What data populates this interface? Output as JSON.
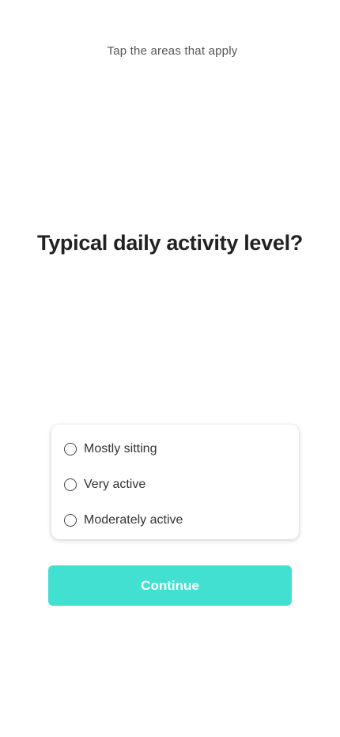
{
  "header": {
    "instruction": "Tap the areas that apply"
  },
  "question": {
    "title": "Typical daily activity level?"
  },
  "options": [
    {
      "label": "Mostly sitting",
      "selected": false
    },
    {
      "label": "Very active",
      "selected": false
    },
    {
      "label": "Moderately active",
      "selected": false
    }
  ],
  "actions": {
    "continue_label": "Continue"
  },
  "colors": {
    "accent": "#42e0d0",
    "text_primary": "#222222",
    "text_secondary": "#555555"
  }
}
